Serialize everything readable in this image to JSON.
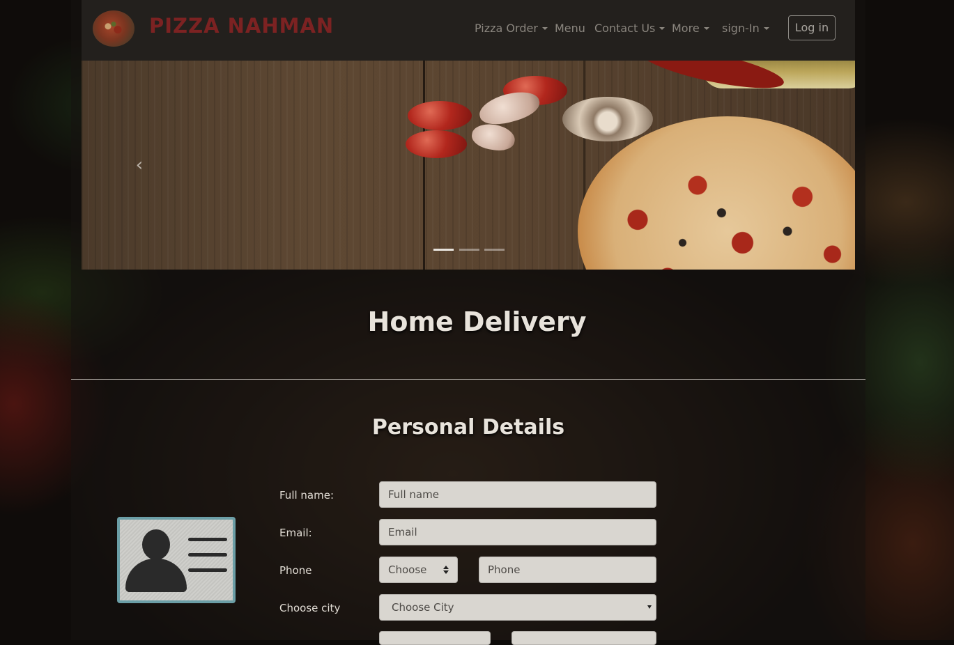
{
  "navbar": {
    "brand": "PIZZA NAHMAN",
    "items": [
      {
        "label": "Pizza Order",
        "dropdown": true
      },
      {
        "label": "Menu",
        "dropdown": false
      },
      {
        "label": "Contact Us",
        "dropdown": true
      },
      {
        "label": "More",
        "dropdown": true
      },
      {
        "label": "sign-In",
        "dropdown": true
      }
    ],
    "login_label": "Log in"
  },
  "carousel": {
    "slide_count": 3,
    "active_slide": 1,
    "prev_icon": "chevron-left-icon"
  },
  "headings": {
    "delivery": "Home Delivery",
    "personal": "Personal Details"
  },
  "form": {
    "full_name": {
      "label": "Full name:",
      "placeholder": "Full name"
    },
    "email": {
      "label": "Email:",
      "placeholder": "Email"
    },
    "phone": {
      "label": "Phone",
      "prefix_selected": "Choose",
      "placeholder": "Phone"
    },
    "city": {
      "label": "Choose city",
      "selected": "Choose City"
    }
  },
  "colors": {
    "brand": "#7c2222",
    "idcard_border": "#6b9ea6",
    "heading": "#e8e3db"
  },
  "icons": {
    "brand_logo": "pizza-logo-icon",
    "idcard": "id-card-icon"
  }
}
